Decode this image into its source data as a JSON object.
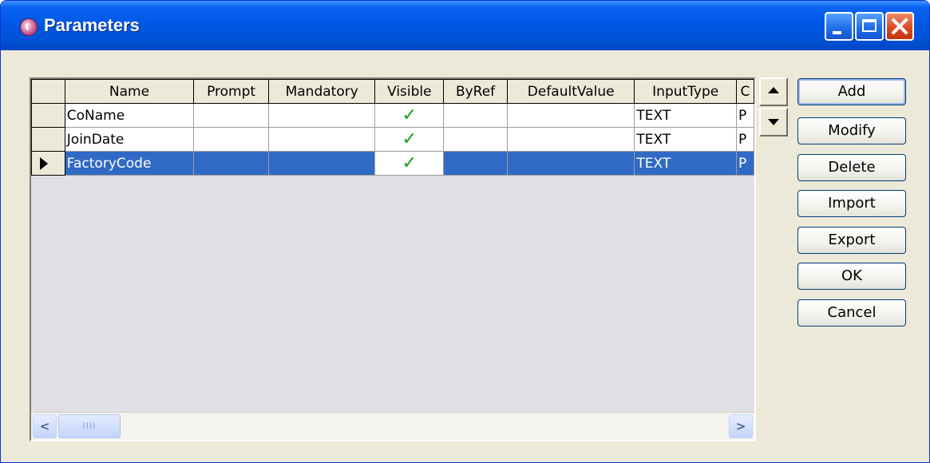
{
  "window": {
    "title": "Parameters"
  },
  "grid": {
    "columns": [
      "Name",
      "Prompt",
      "Mandatory",
      "Visible",
      "ByRef",
      "DefaultValue",
      "InputType",
      "C"
    ],
    "rows": [
      {
        "name": "CoName",
        "prompt": "",
        "mandatory": "",
        "visible": true,
        "byref": "",
        "default_value": "",
        "input_type": "TEXT",
        "c": "P",
        "selected": false
      },
      {
        "name": "JoinDate",
        "prompt": "",
        "mandatory": "",
        "visible": true,
        "byref": "",
        "default_value": "",
        "input_type": "TEXT",
        "c": "P",
        "selected": false
      },
      {
        "name": "FactoryCode",
        "prompt": "",
        "mandatory": "",
        "visible": true,
        "byref": "",
        "default_value": "",
        "input_type": "TEXT",
        "c": "P",
        "selected": true
      }
    ],
    "check_glyph": "✓",
    "scroll": {
      "left": "<",
      "right": ">",
      "thumb_grip": "IIII"
    }
  },
  "order_buttons": {
    "up_icon": "triangle-up-icon",
    "down_icon": "triangle-down-icon"
  },
  "buttons": {
    "add": "Add",
    "modify": "Modify",
    "delete": "Delete",
    "import": "Import",
    "export": "Export",
    "ok": "OK",
    "cancel": "Cancel"
  },
  "colors": {
    "title_bar": "#0053d8",
    "selection": "#316ac5",
    "check": "#11a011",
    "face": "#ece9d8"
  }
}
